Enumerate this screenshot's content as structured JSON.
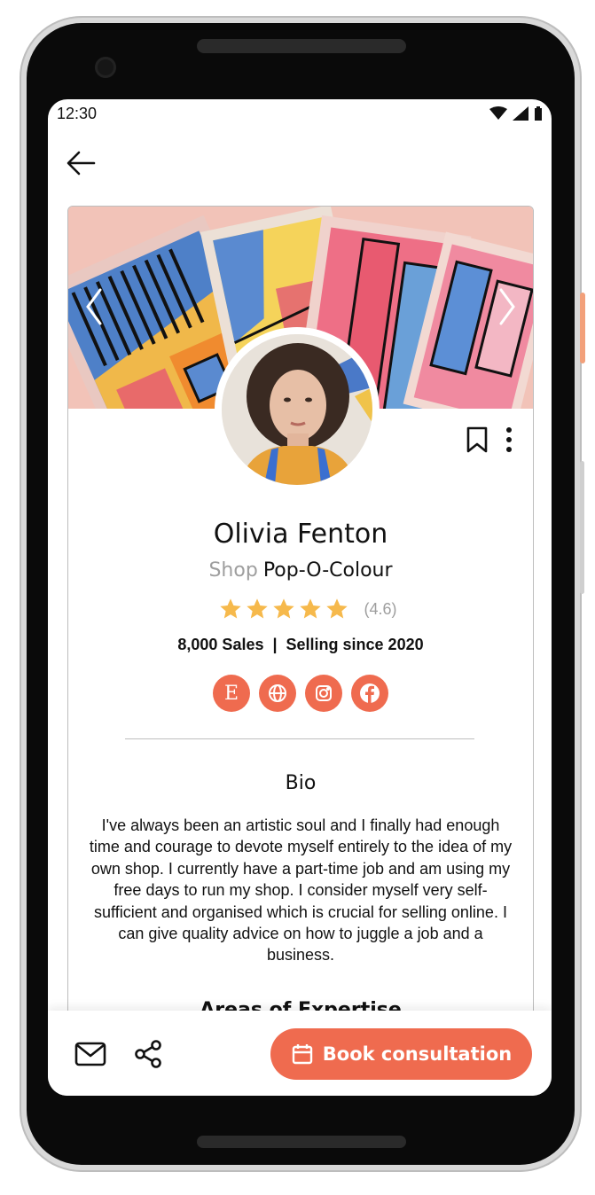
{
  "status_bar": {
    "time": "12:30"
  },
  "profile": {
    "name": "Olivia Fenton",
    "shop_prefix": "Shop",
    "shop_name": "Pop-O-Colour",
    "rating_value": "(4.6)",
    "stars": 5,
    "sales_line": "8,000 Sales  |  Selling since 2020"
  },
  "socials": [
    {
      "name": "etsy-icon",
      "glyph": "E"
    },
    {
      "name": "globe-icon"
    },
    {
      "name": "instagram-icon"
    },
    {
      "name": "facebook-icon"
    }
  ],
  "bio": {
    "title": "Bio",
    "text": "I've always been an artistic soul and I finally had enough time and courage to devote myself entirely to the idea of my own shop. I currently have a part-time job and am using my free days to run my shop. I consider myself very self-sufficient and organised which is crucial for selling online. I can give quality advice on how to juggle a job and a business.",
    "next_section": "Areas of Expertise"
  },
  "actions": {
    "book_label": "Book consultation"
  },
  "colors": {
    "accent": "#ef6b4f",
    "star": "#f6b94c",
    "muted": "#9e9e9e"
  }
}
